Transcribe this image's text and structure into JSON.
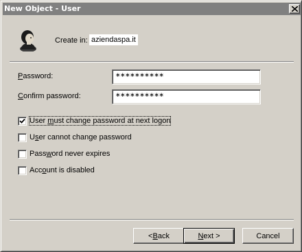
{
  "window": {
    "title": "New Object - User"
  },
  "header": {
    "create_in_label": "Create in:",
    "create_in_value": "aziendaspa.it",
    "icon": "user-icon"
  },
  "fields": {
    "password": {
      "label_underlined": "P",
      "label_rest": "assword:",
      "value": "∗∗∗∗∗∗∗∗∗∗"
    },
    "confirm_password": {
      "label_underlined": "C",
      "label_rest": "onfirm password:",
      "value": "∗∗∗∗∗∗∗∗∗∗"
    }
  },
  "options": [
    {
      "label_pre": "User ",
      "label_underlined": "m",
      "label_post": "ust change password at next logon",
      "checked": true
    },
    {
      "label_pre": "U",
      "label_underlined": "s",
      "label_post": "er cannot change password",
      "checked": false
    },
    {
      "label_pre": "Pass",
      "label_underlined": "w",
      "label_post": "ord never expires",
      "checked": false
    },
    {
      "label_pre": "Acc",
      "label_underlined": "o",
      "label_post": "unt is disabled",
      "checked": false
    }
  ],
  "buttons": {
    "back_pre": "< ",
    "back_underlined": "B",
    "back_post": "ack",
    "next_underlined": "N",
    "next_post": "ext >",
    "cancel": "Cancel"
  },
  "colors": {
    "face": "#d4d0c8",
    "titlebar": "#808080",
    "field": "#ffffff"
  }
}
